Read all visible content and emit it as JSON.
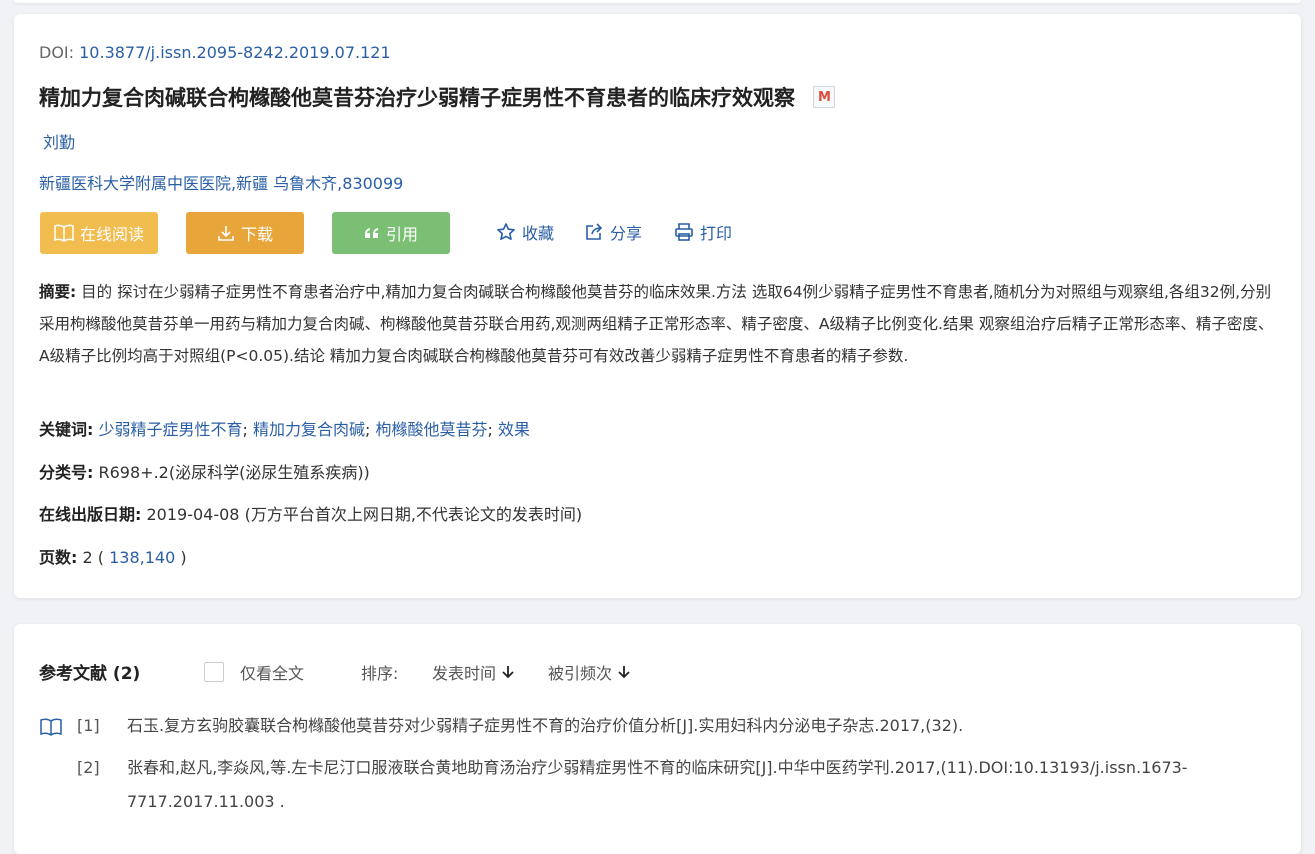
{
  "doi": {
    "label": "DOI:",
    "value": "10.3877/j.issn.2095-8242.2019.07.121"
  },
  "title": "精加力复合肉碱联合枸橼酸他莫昔芬治疗少弱精子症男性不育患者的临床疗效观察",
  "badge": "M",
  "author": "刘勤",
  "affiliation": "新疆医科大学附属中医医院,新疆 乌鲁木齐,830099",
  "actions": {
    "read": "在线阅读",
    "download": "下载",
    "cite": "引用",
    "favorite": "收藏",
    "share": "分享",
    "print": "打印"
  },
  "abstract": {
    "label": "摘要:",
    "text": "目的 探讨在少弱精子症男性不育患者治疗中,精加力复合肉碱联合枸橼酸他莫昔芬的临床效果.方法 选取64例少弱精子症男性不育患者,随机分为对照组与观察组,各组32例,分别采用枸橼酸他莫昔芬单一用药与精加力复合肉碱、枸橼酸他莫昔芬联合用药,观测两组精子正常形态率、精子密度、A级精子比例变化.结果 观察组治疗后精子正常形态率、精子密度、A级精子比例均高于对照组(P<0.05).结论 精加力复合肉碱联合枸橼酸他莫昔芬可有效改善少弱精子症男性不育患者的精子参数."
  },
  "keywords": {
    "label": "关键词:",
    "items": [
      "少弱精子症男性不育",
      "精加力复合肉碱",
      "枸橼酸他莫昔芬",
      "效果"
    ]
  },
  "classification": {
    "label": "分类号:",
    "value": "R698+.2(泌尿科学(泌尿生殖系疾病))"
  },
  "online_date": {
    "label": "在线出版日期:",
    "value": "2019-04-08",
    "note": "(万方平台首次上网日期,不代表论文的发表时间)"
  },
  "pages": {
    "label": "页数:",
    "count": "2",
    "range": "138,140"
  },
  "references": {
    "title": "参考文献",
    "count": "(2)",
    "fulltext_only": "仅看全文",
    "sort_label": "排序:",
    "sort_by_date": "发表时间",
    "sort_by_cited": "被引频次",
    "items": [
      {
        "num": "[1]",
        "text": "石玉.复方玄驹胶囊联合枸橼酸他莫昔芬对少弱精子症男性不育的治疗价值分析[J].实用妇科内分泌电子杂志.2017,(32)."
      },
      {
        "num": "[2]",
        "text": "张春和,赵凡,李焱风,等.左卡尼汀口服液联合黄地助育汤治疗少弱精症男性不育的临床研究[J].中华中医药学刊.2017,(11).DOI:10.13193/j.issn.1673-7717.2017.11.003 ."
      }
    ]
  }
}
